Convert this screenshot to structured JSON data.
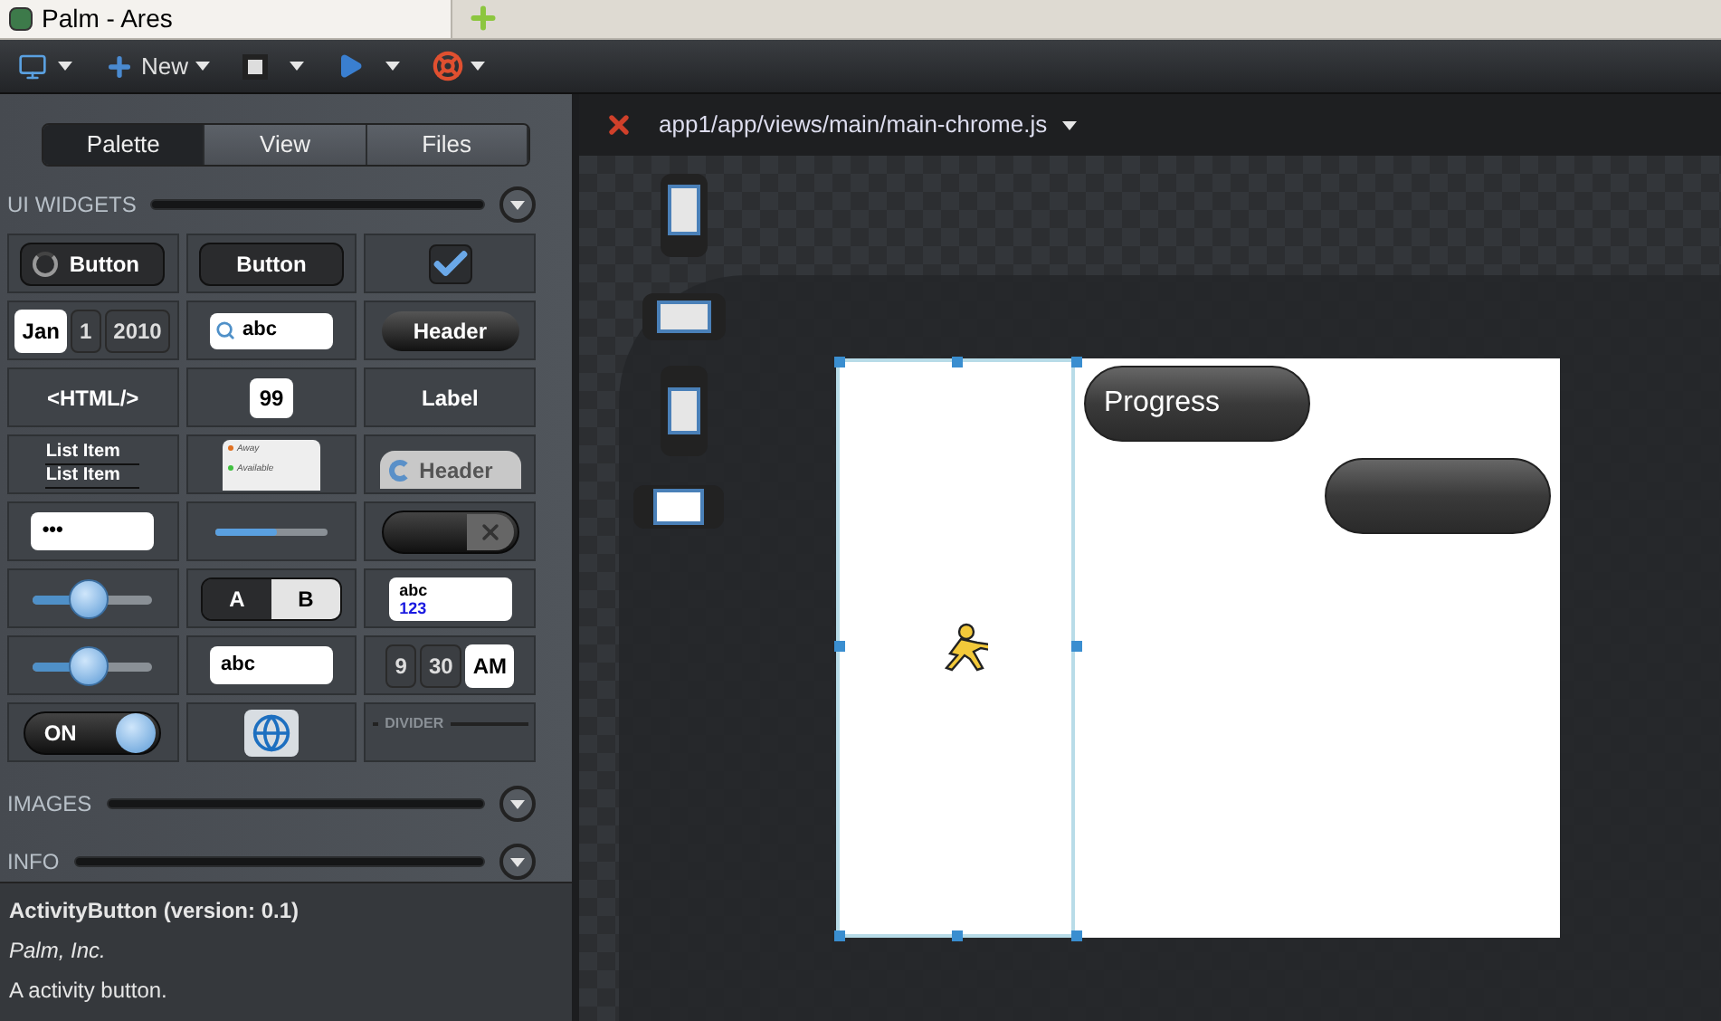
{
  "browser": {
    "tab_title": "Palm - Ares"
  },
  "toolbar": {
    "new_label": "New"
  },
  "palette_tabs": [
    {
      "label": "Palette",
      "selected": true
    },
    {
      "label": "View",
      "selected": false
    },
    {
      "label": "Files",
      "selected": false
    }
  ],
  "sections": {
    "ui_widgets": "UI WIDGETS",
    "images": "IMAGES",
    "info": "INFO"
  },
  "widgets": [
    {
      "kind": "activity-button",
      "label": "Button"
    },
    {
      "kind": "button",
      "label": "Button"
    },
    {
      "kind": "checkbox",
      "checked": true
    },
    {
      "kind": "date-picker",
      "parts": [
        "Jan",
        "1",
        "2010"
      ]
    },
    {
      "kind": "search",
      "value": "abc"
    },
    {
      "kind": "header",
      "label": "Header"
    },
    {
      "kind": "html",
      "label": "<HTML/>"
    },
    {
      "kind": "integer",
      "value": "99"
    },
    {
      "kind": "label",
      "label": "Label"
    },
    {
      "kind": "list",
      "items": [
        "List Item",
        "List Item"
      ]
    },
    {
      "kind": "menu",
      "items": [
        "Away",
        "Available"
      ]
    },
    {
      "kind": "toolbar-header",
      "label": "Header"
    },
    {
      "kind": "password",
      "value": "•••"
    },
    {
      "kind": "progress",
      "level": 0.55
    },
    {
      "kind": "toggle-x",
      "on": false
    },
    {
      "kind": "slider",
      "level": 0.45
    },
    {
      "kind": "radio-group",
      "options": [
        {
          "label": "A",
          "selected": true
        },
        {
          "label": "B",
          "selected": false
        }
      ]
    },
    {
      "kind": "rich-text",
      "lines": [
        "abc",
        "123"
      ]
    },
    {
      "kind": "slider",
      "level": 0.45
    },
    {
      "kind": "text-field",
      "value": "abc"
    },
    {
      "kind": "time-picker",
      "parts": [
        "9",
        "30",
        "AM"
      ]
    },
    {
      "kind": "toggle",
      "on": true,
      "label": "ON"
    },
    {
      "kind": "image"
    },
    {
      "kind": "divider",
      "label": "DIVIDER"
    }
  ],
  "info": {
    "title": "ActivityButton (version: 0.1)",
    "vendor": "Palm, Inc.",
    "description": "A activity button."
  },
  "editor": {
    "file_path": "app1/app/views/main/main-chrome.js"
  },
  "design": {
    "buttons": [
      {
        "kind": "labeled",
        "label": "Progress"
      },
      {
        "kind": "blank"
      }
    ]
  }
}
